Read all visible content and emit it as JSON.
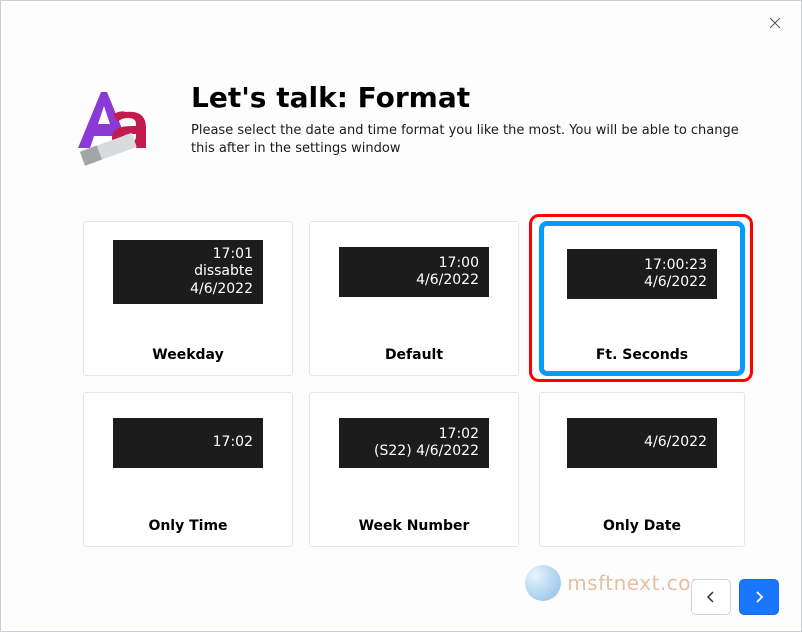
{
  "title": "Let's talk: Format",
  "subtitle": "Please select the date and time format you like the most. You will be able to change this after in the settings window",
  "watermark": "msftnext.com",
  "options": {
    "weekday": {
      "label": "Weekday",
      "line1": "17:01",
      "line2": "dissabte",
      "line3": "4/6/2022"
    },
    "default": {
      "label": "Default",
      "line1": "17:00",
      "line2": "4/6/2022"
    },
    "ftseconds": {
      "label": "Ft. Seconds",
      "line1": "17:00:23",
      "line2": "4/6/2022"
    },
    "onlytime": {
      "label": "Only Time",
      "line1": "17:02"
    },
    "weeknumber": {
      "label": "Week Number",
      "line1": "17:02",
      "line2": "(S22) 4/6/2022"
    },
    "onlydate": {
      "label": "Only Date",
      "line1": "4/6/2022"
    }
  }
}
